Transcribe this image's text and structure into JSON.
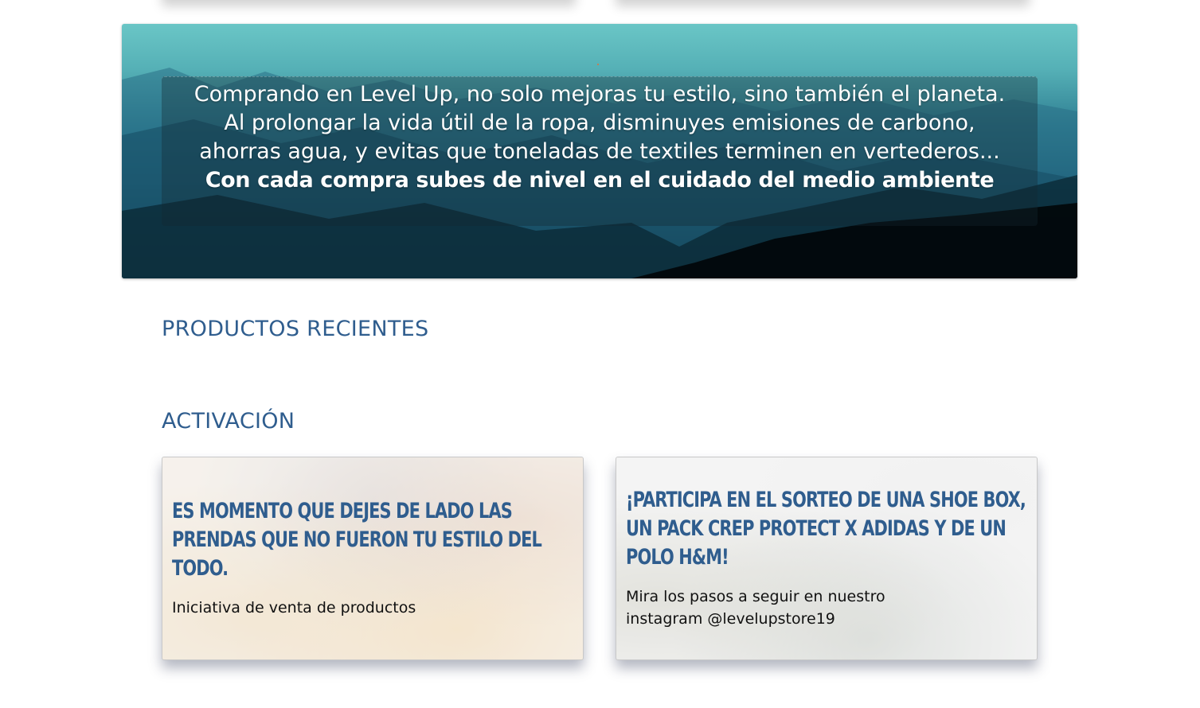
{
  "hero": {
    "text_regular": "Comprando en Level Up, no solo mejoras tu estilo, sino también el planeta. Al prolongar la vida útil de la ropa, disminuyes emisiones de carbono, ahorras agua, y evitas que toneladas de textiles terminen en vertederos...",
    "text_bold": "Con cada compra subes de nivel en el cuidado del medio ambiente"
  },
  "sections": {
    "recientes_title": "PRODUCTOS RECIENTES",
    "activacion_title": "ACTIVACIÓN"
  },
  "activation_cards": [
    {
      "title": "ES MOMENTO QUE DEJES DE LADO LAS PRENDAS QUE NO FUERON TU ESTILO DEL TODO.",
      "description": "Iniciativa de venta de productos"
    },
    {
      "title": "¡PARTICIPA EN EL SORTEO DE UNA SHOE BOX, UN PACK CREP PROTECT X ADIDAS Y DE UN POLO H&M!",
      "description": "Mira los pasos a seguir en nuestro instagram @levelupstore19"
    }
  ],
  "colors": {
    "title_blue": "#2f5d8e",
    "hero_teal": "#55b0b6"
  }
}
